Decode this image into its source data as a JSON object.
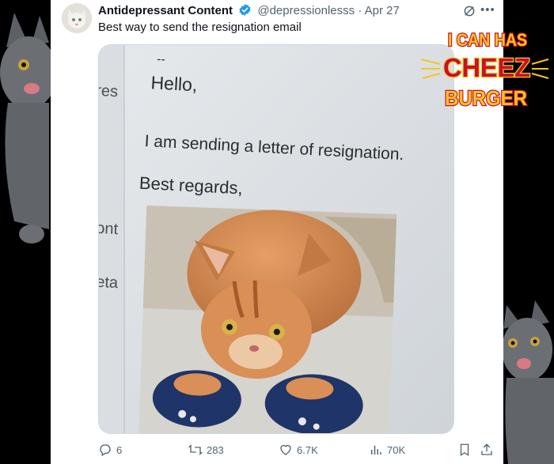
{
  "tweet": {
    "author": "Antidepressant Content",
    "handle": "@depressionlesss",
    "separator": "·",
    "date": "Apr 27",
    "text": "Best way to send the resignation email"
  },
  "media": {
    "sidebar_fragments": [
      "res",
      "ont",
      "eta"
    ],
    "dash": "--",
    "greeting": "Hello,",
    "body_line": "I am sending a letter of resignation.",
    "closing": "Best regards,"
  },
  "actions": {
    "replies": "6",
    "reposts": "283",
    "likes": "6.7K",
    "views": "70K"
  },
  "logo": {
    "line1": "I CAN HAS",
    "line2": "CHEEZ",
    "line3": "BURGER",
    "colors": {
      "yellow": "#f7c51e",
      "red": "#c8102e"
    }
  },
  "colors": {
    "verified": "#1d9bf0",
    "muted": "#536471",
    "text": "#0f1419"
  }
}
